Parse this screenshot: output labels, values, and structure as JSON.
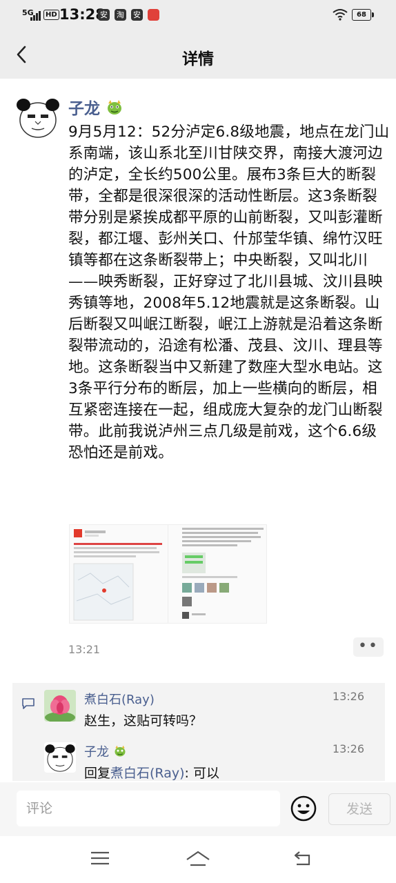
{
  "status_bar": {
    "network": "5G",
    "hd": "HD",
    "time": "13:28",
    "apps": [
      "安",
      "淘",
      "安"
    ],
    "battery": "68"
  },
  "nav": {
    "title": "详情"
  },
  "post": {
    "author": "子龙",
    "text": "9月5月12：52分泸定6.8级地震，地点在龙门山系南端，该山系北至川甘陕交界，南接大渡河边的泸定，全长约500公里。展布3条巨大的断裂带，全都是很深很深的活动性断层。这3条断裂带分别是紧挨成都平原的山前断裂，又叫彭灌断裂，都江堰、彭州关口、什邡莹华镇、绵竹汉旺镇等都在这条断裂带上；中央断裂，又叫北川——映秀断裂，正好穿过了北川县城、汶川县映秀镇等地，2008年5.12地震就是这条断裂。山后断裂又叫岷江断裂，岷江上游就是沿着这条断裂带流动的，沿途有松潘、茂县、汶川、理县等地。这条断裂当中又新建了数座大型水电站。这3条平行分布的断层，加上一些横向的断层，相互紧密连接在一起，组成庞大复杂的龙门山断裂带。此前我说泸州三点几级是前戏，这个6.6级恐怕还是前戏。",
    "time": "13:21",
    "more": "••"
  },
  "comments": [
    {
      "name": "煮白石(Ray)",
      "time": "13:26",
      "text": "赵生，这贴可转吗？"
    },
    {
      "name": "子龙",
      "time": "13:26",
      "reply_prefix": "回复",
      "reply_to": "煮白石(Ray)",
      "text": ": 可以"
    }
  ],
  "input": {
    "placeholder": "评论",
    "send": "发送"
  }
}
